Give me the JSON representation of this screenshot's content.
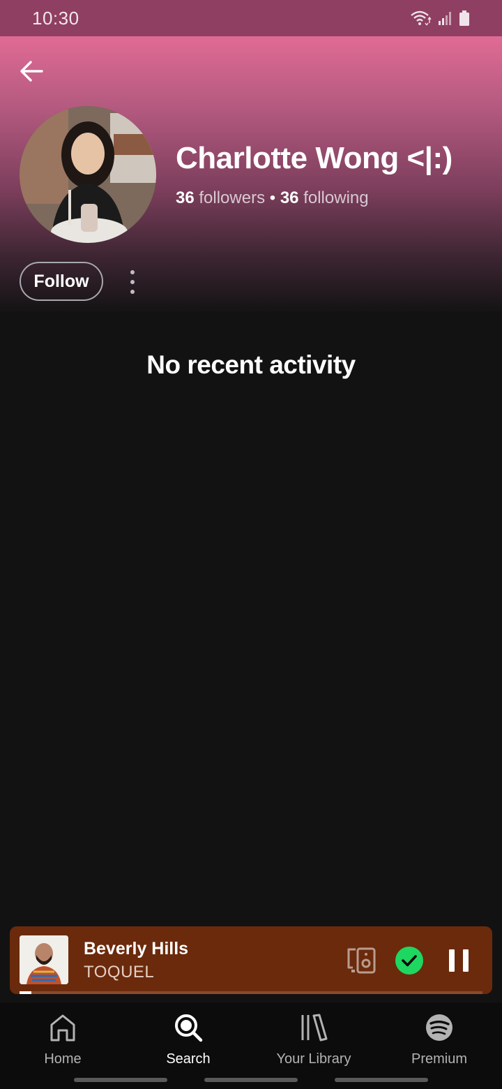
{
  "status_bar": {
    "time": "10:30"
  },
  "profile": {
    "name": "Charlotte Wong <|:)",
    "followers_count": "36",
    "followers_label": "followers",
    "separator": "•",
    "following_count": "36",
    "following_label": "following"
  },
  "actions": {
    "follow_label": "Follow"
  },
  "content": {
    "empty_message": "No recent activity"
  },
  "now_playing": {
    "title": "Beverly Hills",
    "artist": "TOQUEL",
    "progress": 0.025,
    "accent_color": "#1ed760"
  },
  "nav": {
    "items": [
      {
        "label": "Home",
        "icon": "home-icon",
        "active": false
      },
      {
        "label": "Search",
        "icon": "search-icon",
        "active": true
      },
      {
        "label": "Your Library",
        "icon": "library-icon",
        "active": false
      },
      {
        "label": "Premium",
        "icon": "spotify-icon",
        "active": false
      }
    ]
  },
  "colors": {
    "header_top": "#e06b94",
    "status_bar": "#8f3f62",
    "background": "#121212",
    "mini_player": "#6b2a0c",
    "accent_green": "#1ed760"
  }
}
